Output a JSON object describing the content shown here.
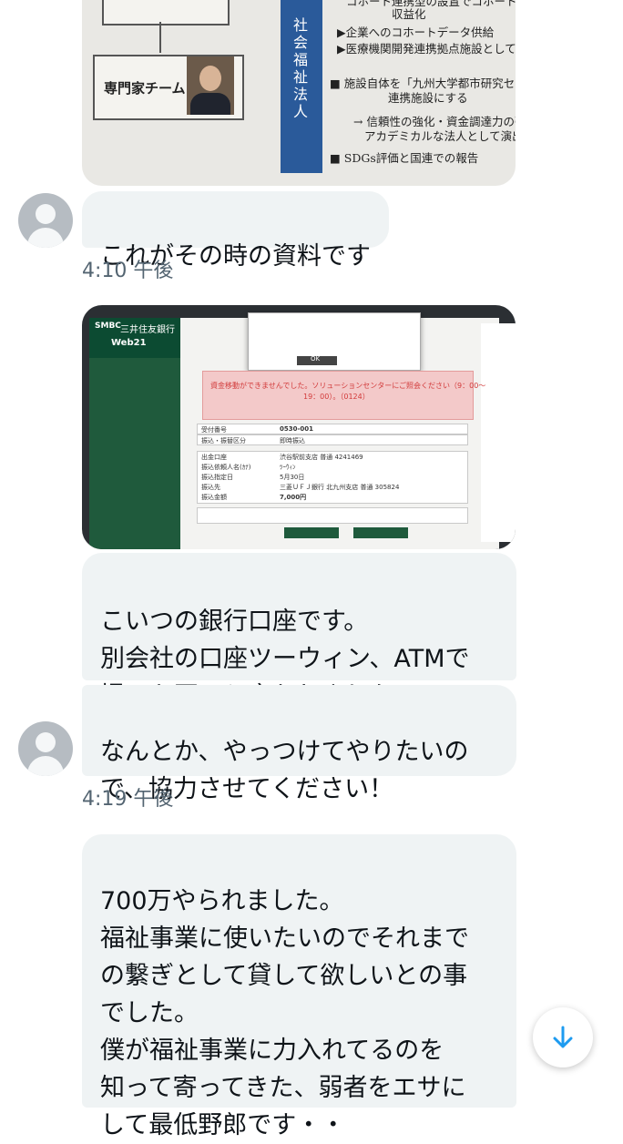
{
  "conversation": {
    "messages": [
      {
        "type": "image",
        "image": "document-photo"
      },
      {
        "type": "text",
        "text": "これがその時の資料です",
        "timestamp": "4:10 午後"
      },
      {
        "type": "image",
        "image": "bank-screen-photo"
      },
      {
        "type": "text",
        "text": "こいつの銀行口座です。\n別会社の口座ツーウィン、ATMで\n撮った写メと言われました。"
      },
      {
        "type": "text",
        "text": "なんとか、やっつけてやりたいの\nで、協力させてください！",
        "timestamp": "4:19 午後"
      },
      {
        "type": "text",
        "text": "700万やられました。\n福祉事業に使いたいのでそれまで\nの繋ぎとして貸して欲しいとの事\nでした。\n僕が福祉事業に力入れてるのを\n知って寄ってきた、弱者をエサに\nして最低野郎です・・"
      }
    ]
  },
  "document_photo": {
    "team_label": "専門家チーム",
    "vertical_label": "社会福祉法人",
    "notes": [
      "コホート連携型の設置でコホート",
      "収益化",
      "▶企業へのコホートデータ供給",
      "▶医療機関開発連携拠点施設としても収益化",
      "■ 施設自体を「九州大学都市研究センター",
      "連携施設にする",
      "→ 信頼性の強化・資金調達力の強化、",
      "アカデミカルな法人として演出",
      "■ SDGs評価と国連での報告"
    ]
  },
  "bank_photo": {
    "brand_name": "三井住友銀行",
    "brand_abbr": "SMBC",
    "brand_sub": "Web21",
    "ok_label": "OK",
    "error_line1": "資金移動ができませんでした。ソリューションセンターにご照会ください（9：00～",
    "error_line2": "19：00）。（0124）",
    "fields": [
      "受付番号",
      "振込・振替区分",
      "出金口座",
      "振込依頼人名(ｶﾅ)",
      "振込指定日",
      "振込先",
      "振込金額"
    ],
    "values": [
      "0530-001",
      "即時振込",
      "渋谷駅前支店 普通 4241469",
      "ﾂｰｳｨﾝ",
      "5月30日",
      "三菱ＵＦＪ銀行 北九州支店 普通 305824",
      "7,000円"
    ]
  },
  "icons": {
    "scroll_down": "arrow-down-icon",
    "avatar": "default-avatar-icon"
  },
  "colors": {
    "bubble": "#eff3f4",
    "timestamp": "#536471",
    "accent": "#1d9bf0"
  }
}
